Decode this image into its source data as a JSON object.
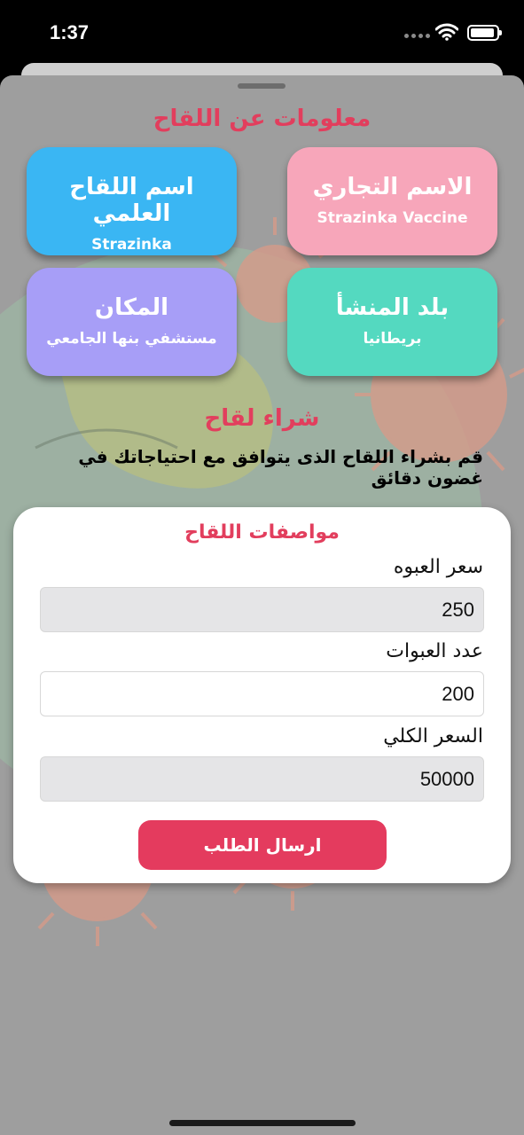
{
  "status_bar": {
    "time": "1:37"
  },
  "info": {
    "title": "معلومات عن اللقاح",
    "cards": [
      {
        "title": "الاسم التجاري",
        "value": "Strazinka Vaccine",
        "color": "#f7a6ba"
      },
      {
        "title": "اسم اللقاح العلمي",
        "value": "Strazinka",
        "color": "#3ab6f3"
      },
      {
        "title": "بلد المنشأ",
        "value": "بريطانيا",
        "color": "#54d9c0"
      },
      {
        "title": "المكان",
        "value": "مستشفي بنها الجامعي",
        "color": "#a79ef7"
      }
    ]
  },
  "purchase": {
    "title": "شراء لقاح",
    "description": "قم بشراء اللقاح الذى يتوافق مع احتياجاتك في غضون دقائق"
  },
  "specs": {
    "title": "مواصفات اللقاح",
    "price_label": "سعر العبوه",
    "price_value": "250",
    "count_label": "عدد العبوات",
    "count_value": "200",
    "total_label": "السعر الكلي",
    "total_value": "50000",
    "submit_label": "ارسال الطلب"
  },
  "colors": {
    "accent": "#e23e5d",
    "button": "#e43b5e",
    "overlay": "#9e9e9e"
  }
}
